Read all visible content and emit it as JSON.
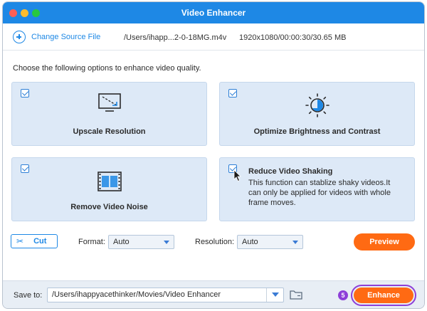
{
  "window": {
    "title": "Video Enhancer"
  },
  "file": {
    "change_source_label": "Change Source File",
    "path": "/Users/ihapp...2-0-18MG.m4v",
    "info": "1920x1080/00:00:30/30.65 MB"
  },
  "instructions": "Choose the following options to enhance video quality.",
  "options": [
    {
      "title": "Upscale Resolution",
      "checked": true,
      "icon": "upscale-monitor-icon"
    },
    {
      "title": "Optimize Brightness and Contrast",
      "checked": true,
      "icon": "brightness-sun-icon"
    },
    {
      "title": "Remove Video Noise",
      "checked": true,
      "icon": "film-strip-icon"
    },
    {
      "title": "Reduce Video Shaking",
      "checked": true,
      "icon": "cursor-pointer-icon",
      "description": "This function can stablize shaky videos.It can only be applied for videos with whole frame moves."
    }
  ],
  "controls": {
    "cut_label": "Cut",
    "format_label": "Format:",
    "format_value": "Auto",
    "resolution_label": "Resolution:",
    "resolution_value": "Auto",
    "preview_label": "Preview"
  },
  "save": {
    "label": "Save to:",
    "path": "/Users/ihappyacethinker/Movies/Video Enhancer",
    "step_number": "5",
    "enhance_label": "Enhance"
  },
  "colors": {
    "title_bar": "#1e88e5",
    "accent": "#1e88e5",
    "action_orange": "#ff6a13",
    "highlight_purple": "#8d3fd8",
    "card_bg": "#dde9f7"
  }
}
